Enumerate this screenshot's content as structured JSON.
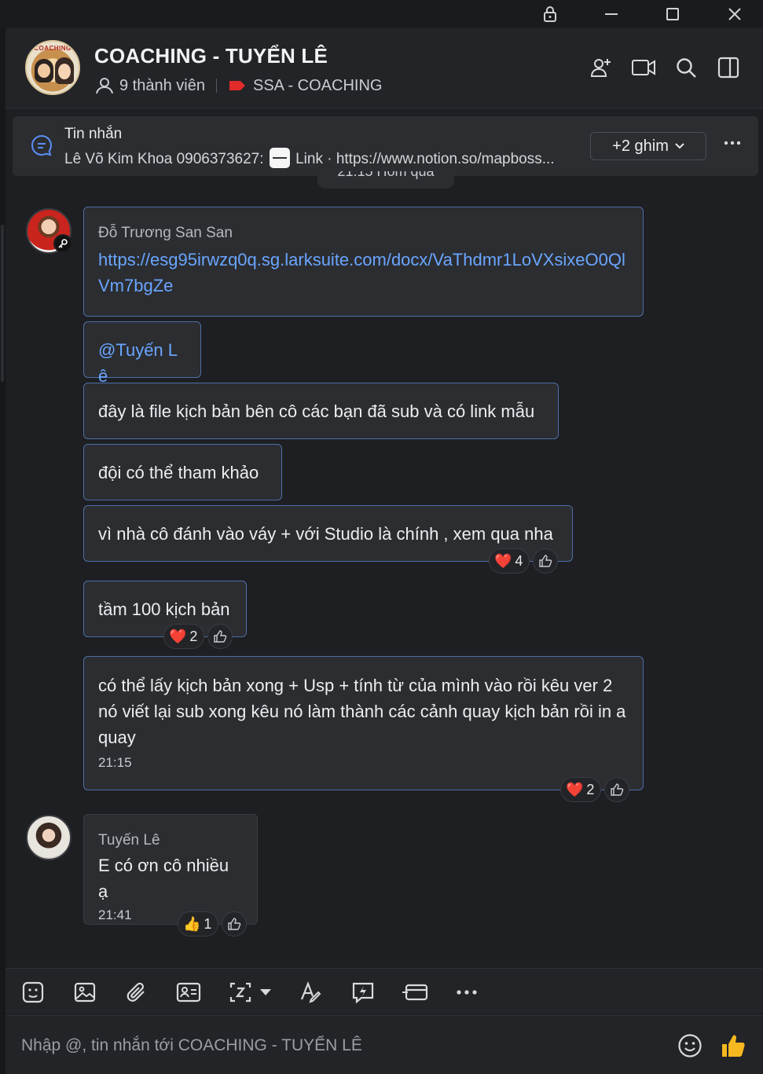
{
  "window": {
    "controls": [
      "lock-icon",
      "minimize-icon",
      "maximize-icon",
      "close-icon"
    ]
  },
  "header": {
    "group_name": "COACHING - TUYỂN LÊ",
    "avatar_text": "COACHING",
    "members": "9 thành viên",
    "tag": "SSA - COACHING",
    "tag_color": "#e32b2b",
    "actions": [
      "add-member-icon",
      "video-call-icon",
      "search-icon",
      "side-panel-icon"
    ]
  },
  "pinned": {
    "title": "Tin nhắn",
    "preview_prefix": "Lê Võ Kim Khoa 0906373627:",
    "preview_suffix": "Link · https://www.notion.so/mapboss...",
    "more_label": "+2 ghim",
    "date_divider": "21:15 Hôm qua"
  },
  "messages": [
    {
      "sender": "Đỗ Trương San San",
      "link": "https://esg95irwzq0q.sg.larksuite.com/docx/VaThdmr1LoVXsixeO0QlVm7bgZe"
    },
    {
      "mention": "@Tuyến Lê"
    },
    {
      "text": "đây là file kịch bản bên cô các bạn đã sub và có link mẫu"
    },
    {
      "text": "đội có thể tham khảo"
    },
    {
      "text": "vì nhà cô đánh vào váy + với Studio là chính , xem qua nha",
      "reaction": "❤️",
      "reaction_count": "4"
    },
    {
      "text": "tầm 100 kịch bản",
      "reaction": "❤️",
      "reaction_count": "2"
    },
    {
      "text": "có thể lấy kịch bản xong + Usp + tính từ của mình vào rồi kêu ver 2 nó viết lại sub xong kêu nó làm thành các cảnh quay kịch bản rồi in a quay",
      "time": "21:15",
      "reaction": "❤️",
      "reaction_count": "2"
    },
    {
      "sender": "Tuyến Lê",
      "text": "E có ơn cô nhiều ạ",
      "time": "21:41",
      "reaction": "👍",
      "reaction_count": "1"
    }
  ],
  "composer": {
    "tools": [
      "sticker-icon",
      "image-icon",
      "attach-icon",
      "contact-card-icon",
      "screenshot-icon",
      "dropdown-arrow-icon",
      "text-format-icon",
      "quick-message-icon",
      "card-icon",
      "more-icon"
    ],
    "placeholder": "Nhập @, tin nhắn tới COACHING - TUYỂN LÊ",
    "accent": "#f5b81f"
  }
}
